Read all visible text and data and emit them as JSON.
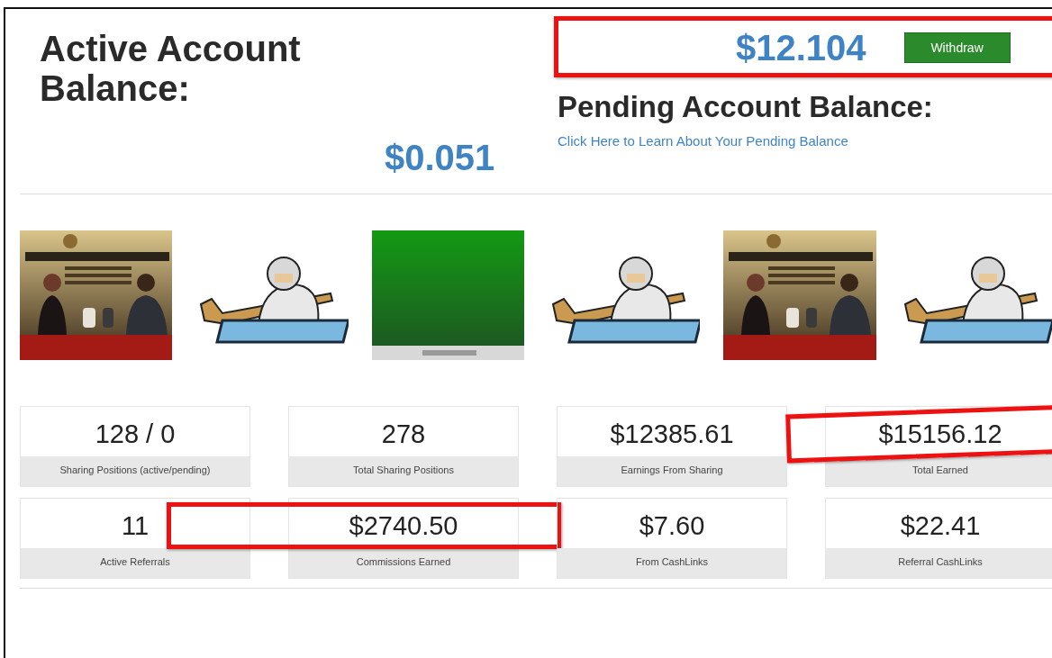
{
  "active_balance": {
    "title": "Active Account Balance:",
    "amount": "$12.104",
    "highlighted": true,
    "button": "Withdraw"
  },
  "pending_balance": {
    "title": "Pending Account Balance:",
    "link": "Click Here to Learn About Your Pending Balance",
    "amount": "$0.051"
  },
  "stats": [
    {
      "value": "128 / 0",
      "label": "Sharing Positions (active/pending)",
      "highlighted": false
    },
    {
      "value": "278",
      "label": "Total Sharing Positions",
      "highlighted": false
    },
    {
      "value": "$12385.61",
      "label": "Earnings From Sharing",
      "highlighted": false
    },
    {
      "value": "$15156.12",
      "label": "Total Earned",
      "highlighted": true
    },
    {
      "value": "11",
      "label": "Active Referrals",
      "highlighted": false
    },
    {
      "value": "$2740.50",
      "label": "Commissions Earned",
      "highlighted": true
    },
    {
      "value": "$7.60",
      "label": "From CashLinks",
      "highlighted": false
    },
    {
      "value": "$22.41",
      "label": "Referral CashLinks",
      "highlighted": false
    }
  ]
}
